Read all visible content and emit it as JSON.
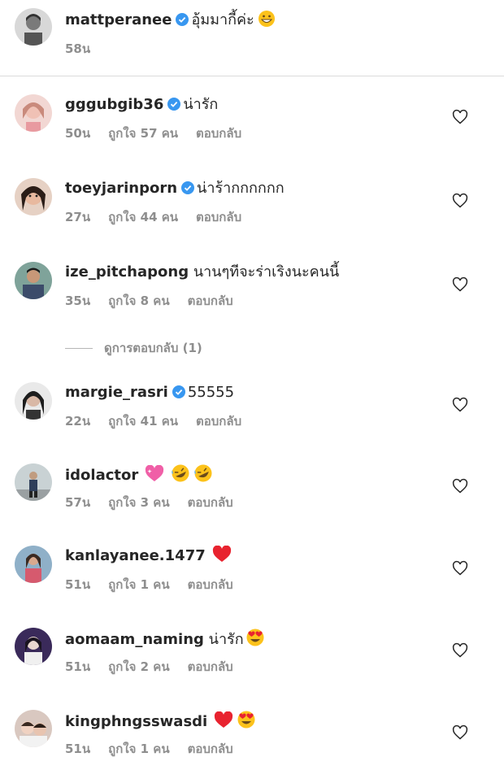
{
  "caption": {
    "username": "mattperanee",
    "verified": true,
    "text": "อุ้มมากี้ค่ะ",
    "emojis": [
      "grinning-face"
    ],
    "time": "58น"
  },
  "comments": [
    {
      "username": "gggubgib36",
      "verified": true,
      "text": "น่ารัก",
      "emojis": [],
      "time": "50น",
      "likes": "ถูกใจ 57 คน",
      "reply": "ตอบกลับ"
    },
    {
      "username": "toeyjarinporn",
      "verified": true,
      "text": "น่าร้ากกกกกก",
      "emojis": [],
      "time": "27น",
      "likes": "ถูกใจ 44 คน",
      "reply": "ตอบกลับ"
    },
    {
      "username": "ize_pitchapong",
      "verified": false,
      "text": "นานๆทีจะร่าเริงนะคนนี้",
      "emojis": [],
      "time": "35น",
      "likes": "ถูกใจ 8 คน",
      "reply": "ตอบกลับ"
    },
    {
      "username": "margie_rasri",
      "verified": true,
      "text": "55555",
      "emojis": [],
      "time": "22น",
      "likes": "ถูกใจ 41 คน",
      "reply": "ตอบกลับ"
    },
    {
      "username": "idolactor",
      "verified": false,
      "text": "",
      "emojis": [
        "pink-heart",
        "rofl",
        "rofl"
      ],
      "time": "57น",
      "likes": "ถูกใจ 3 คน",
      "reply": "ตอบกลับ"
    },
    {
      "username": "kanlayanee.1477",
      "verified": false,
      "text": "",
      "emojis": [
        "red-heart"
      ],
      "time": "51น",
      "likes": "ถูกใจ 1 คน",
      "reply": "ตอบกลับ"
    },
    {
      "username": "aomaam_naming",
      "verified": false,
      "text": "น่ารัก",
      "emojis": [
        "heart-eyes"
      ],
      "time": "51น",
      "likes": "ถูกใจ 2 คน",
      "reply": "ตอบกลับ"
    },
    {
      "username": "kingphngsswasdi",
      "verified": false,
      "text": "",
      "emojis": [
        "red-heart",
        "heart-eyes"
      ],
      "time": "51น",
      "likes": "ถูกใจ 1 คน",
      "reply": "ตอบกลับ"
    }
  ],
  "view_replies": "ดูการตอบกลับ (1)",
  "colors": {
    "text": "#262626",
    "meta": "#8e8e8e",
    "verified": "#3897f0",
    "divider": "#dbdbdb"
  }
}
